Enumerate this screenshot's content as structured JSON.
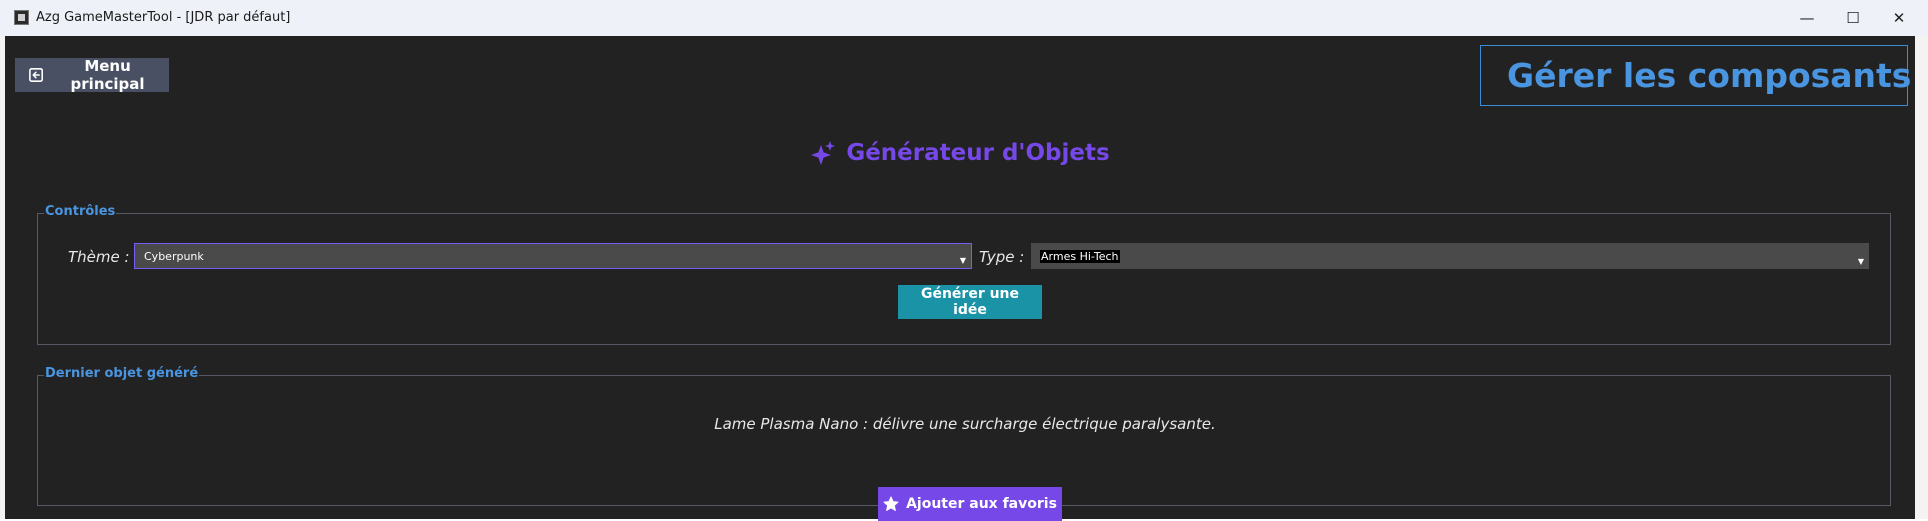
{
  "window": {
    "title": "Azg GameMasterTool - [JDR par défaut]",
    "minimize_glyph": "—",
    "maximize_glyph": "☐",
    "close_glyph": "✕"
  },
  "header": {
    "menu_label": "Menu principal",
    "menu_icon": "back-arrow-icon",
    "manage_label": "Gérer les composants",
    "manage_icon": "gear-icon"
  },
  "page": {
    "title": "Générateur d'Objets",
    "title_icon": "sparkles-icon"
  },
  "controls": {
    "legend": "Contrôles",
    "theme_label": "Thème :",
    "theme_value": "Cyberpunk",
    "type_label": "Type :",
    "type_value": "Armes Hi-Tech",
    "generate_label": "Générer une idée"
  },
  "last_item": {
    "legend": "Dernier objet généré",
    "text": "Lame Plasma Nano : délivre une surcharge électrique paralysante.",
    "favorite_label": "Ajouter aux favoris",
    "favorite_icon": "star-icon"
  },
  "colors": {
    "background": "#222222",
    "accent_purple": "#7648e8",
    "accent_blue": "#4a95e0",
    "teal_button": "#1993a5",
    "menu_button": "#4a5063"
  }
}
